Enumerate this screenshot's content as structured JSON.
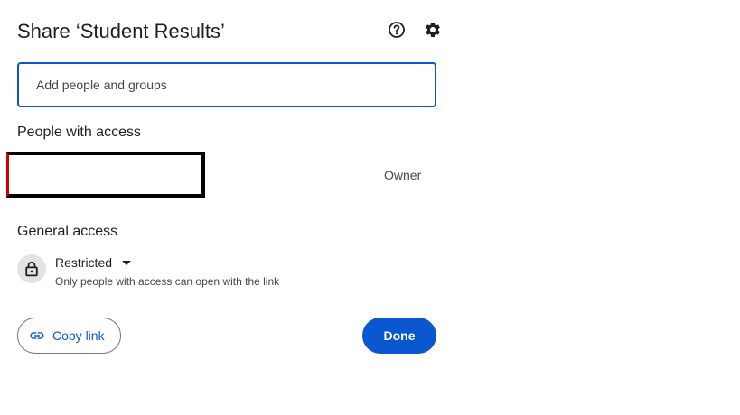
{
  "dialog": {
    "title": "Share ‘Student Results’",
    "help_icon": "help-circle-icon",
    "settings_icon": "gear-icon"
  },
  "add_people": {
    "placeholder": "Add people and groups",
    "value": ""
  },
  "people_with_access": {
    "heading": "People with access",
    "entries": [
      {
        "name": "",
        "role": "Owner",
        "redacted": true
      }
    ]
  },
  "general_access": {
    "heading": "General access",
    "icon": "lock-icon",
    "selected": "Restricted",
    "description": "Only people with access can open with the link"
  },
  "actions": {
    "copy_link_label": "Copy link",
    "copy_link_icon": "link-icon",
    "done_label": "Done"
  },
  "colors": {
    "accent": "#0b57d0",
    "text": "#1f1f1f",
    "secondary_text": "#444746",
    "lock_bg": "#e3e3e3"
  }
}
